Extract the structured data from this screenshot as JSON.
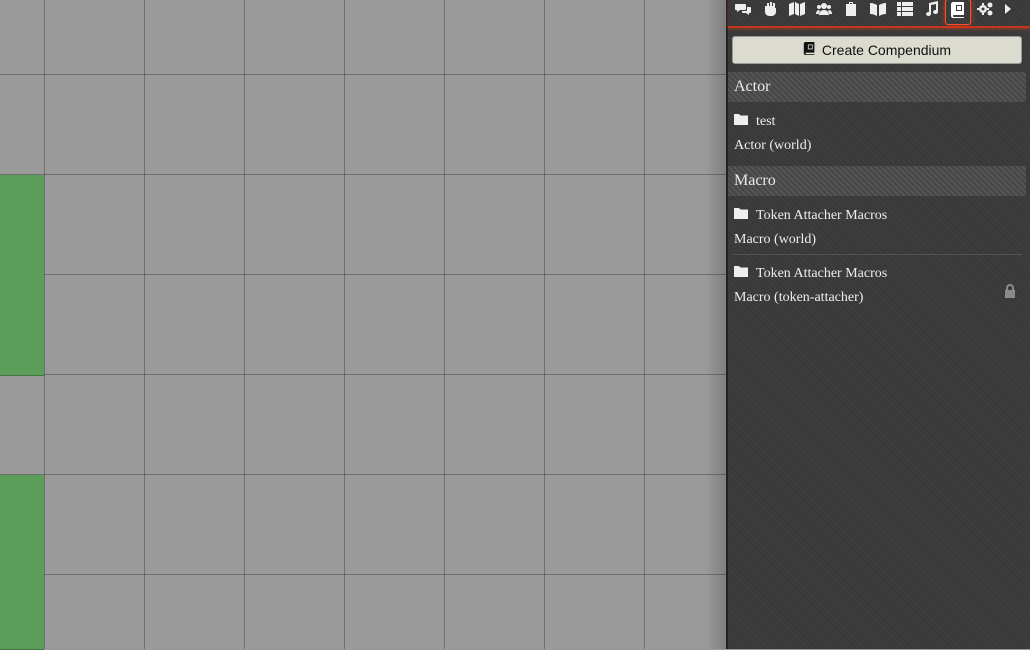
{
  "sidebar": {
    "tabs": [
      {
        "name": "chat",
        "icon": "comments-icon"
      },
      {
        "name": "combat",
        "icon": "fist-icon"
      },
      {
        "name": "scenes",
        "icon": "map-icon"
      },
      {
        "name": "actors",
        "icon": "users-icon"
      },
      {
        "name": "items",
        "icon": "suitcase-icon"
      },
      {
        "name": "journal",
        "icon": "book-open-icon"
      },
      {
        "name": "tables",
        "icon": "th-list-icon"
      },
      {
        "name": "playlists",
        "icon": "music-icon"
      },
      {
        "name": "compendium",
        "icon": "atlas-icon",
        "active": true
      },
      {
        "name": "settings",
        "icon": "cogs-icon"
      },
      {
        "name": "collapse",
        "icon": "caret-right-icon"
      }
    ],
    "create_button_label": "Create Compendium",
    "sections": [
      {
        "title": "Actor",
        "packs": [
          {
            "folder": "test",
            "subtitle": "Actor (world)",
            "locked": false
          }
        ]
      },
      {
        "title": "Macro",
        "packs": [
          {
            "folder": "Token Attacher Macros",
            "subtitle": "Macro (world)",
            "locked": false
          },
          {
            "folder": "Token Attacher Macros",
            "subtitle": "Macro (token-attacher)",
            "locked": true
          }
        ]
      }
    ]
  },
  "colors": {
    "canvas_bg": "#9a9a9a",
    "green_tile": "#5a9e5a",
    "sidebar_bg": "#3a3a3a",
    "accent": "#c9321c"
  }
}
